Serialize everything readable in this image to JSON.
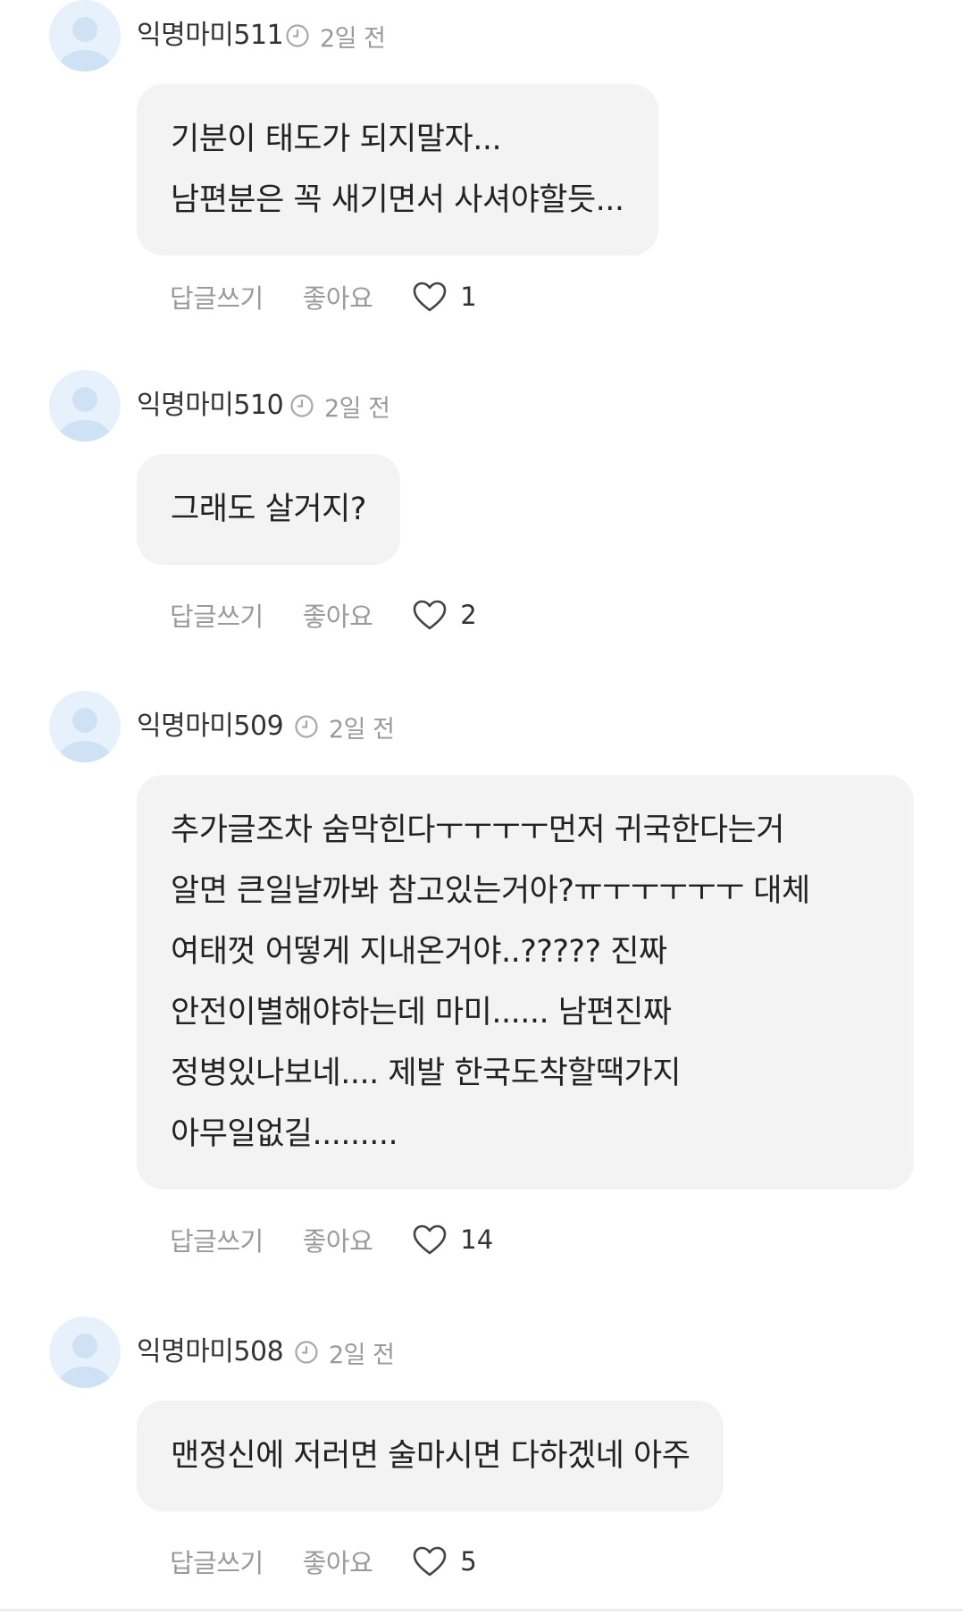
{
  "comments": [
    {
      "author": "익명마미511",
      "time": "2일 전",
      "lines": [
        "기분이 태도가 되지말자...",
        "남편분은 꼭 새기면서 사셔야할듯..."
      ],
      "reply_label": "답글쓰기",
      "like_label": "좋아요",
      "like_count": "1"
    },
    {
      "author": "익명마미510",
      "time": "2일 전",
      "lines": [
        "그래도 살거지?"
      ],
      "reply_label": "답글쓰기",
      "like_label": "좋아요",
      "like_count": "2"
    },
    {
      "author": "익명마미509",
      "time": "2일 전",
      "lines": [
        "추가글조차 숨막힌다ㅜㅜㅜㅜ먼저 귀국한다는거",
        "알면 큰일날까봐 참고있는거아?ㅠㅜㅜㅜㅜㅜ 대체",
        "여태껏 어떻게 지내온거야..????? 진짜",
        "안전이별해야하는데 마미...... 남편진짜",
        "정병있나보네.... 제발 한국도착할땍가지",
        "아무일없길........."
      ],
      "reply_label": "답글쓰기",
      "like_label": "좋아요",
      "like_count": "14"
    },
    {
      "author": "익명마미508",
      "time": "2일 전",
      "lines": [
        "맨정신에 저러면 술마시면 다하겠네 아주"
      ],
      "reply_label": "답글쓰기",
      "like_label": "좋아요",
      "like_count": "5"
    }
  ],
  "icons": {
    "avatar": "default-avatar-icon",
    "time": "clock-icon",
    "like": "heart-outline-icon"
  },
  "colors": {
    "bubble_bg": "#f3f3f3",
    "avatar_bg": "#e7f1fb",
    "avatar_fg": "#cfe2f5",
    "muted_text": "#9a9a9a"
  }
}
